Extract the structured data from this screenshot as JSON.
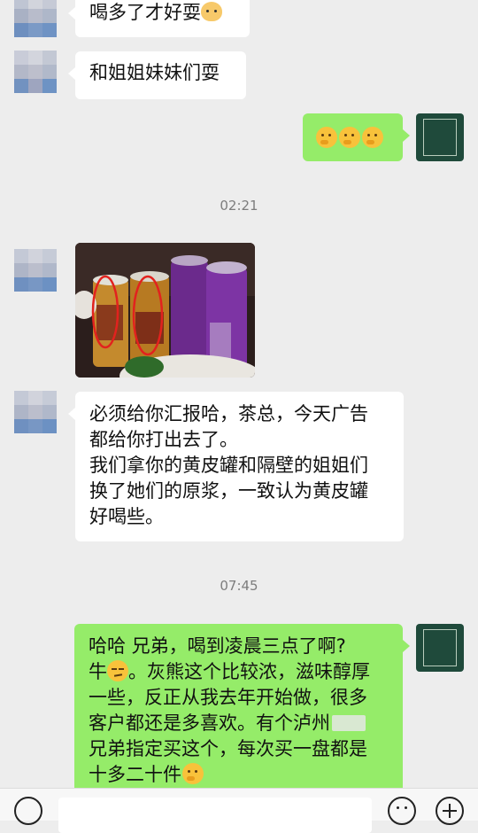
{
  "messages": {
    "m1_text": "喝多了才好耍",
    "m2_text": "和姐姐妹妹们耍",
    "m5_line1": "必须给你汇报哈，茶总，今天广告",
    "m5_line2": "都给你打出去了。",
    "m5_line3": "我们拿你的黄皮罐和隔壁的姐姐们",
    "m5_line4": "换了她们的原浆，一致认为黄皮罐",
    "m5_line5": "好喝些。",
    "m6_line1": "哈哈 兄弟，喝到凌晨三点了啊?",
    "m6_line2_a": "牛",
    "m6_line2_b": "。灰熊这个比较浓，滋味醇厚",
    "m6_line3": "一些，反正从我去年开始做，很多",
    "m6_line4_a": "客户都还是多喜欢。有个泸州",
    "m6_line5": "兄弟指定买这个，每次买一盘都是",
    "m6_line6": "十多二十件"
  },
  "timestamps": {
    "t1": "02:21",
    "t2": "07:45"
  },
  "colors": {
    "background": "#ededed",
    "incoming_bubble": "#ffffff",
    "outgoing_bubble": "#95ec69",
    "brand_avatar": "#1f4a3b"
  },
  "icons": {
    "m1_emoji": "dog-emoji",
    "m3_emoji": "thinking-face-emoji",
    "m6_emoji_a": "smirk-emoji",
    "m6_emoji_b": "thinking-face-emoji"
  }
}
